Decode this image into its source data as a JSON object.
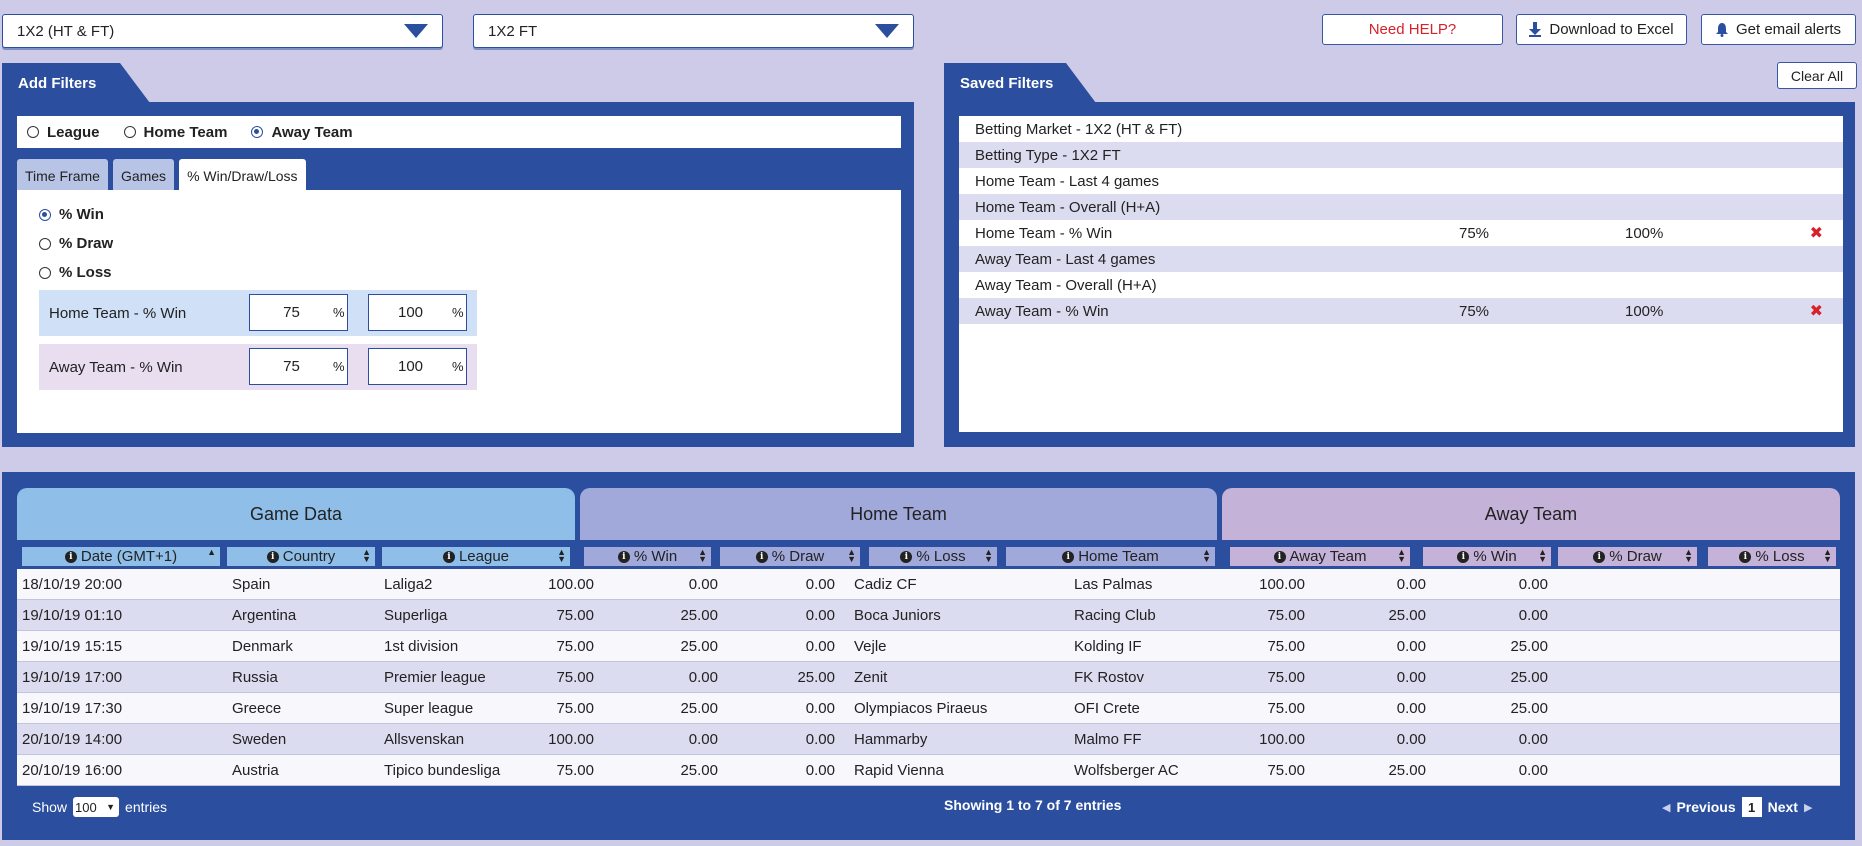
{
  "top": {
    "market_select": "1X2 (HT & FT)",
    "type_select": "1X2 FT",
    "help_label": "Need HELP?",
    "download_label": "Download to Excel",
    "alerts_label": "Get email alerts"
  },
  "add_filters": {
    "title": "Add Filters",
    "scope": [
      "League",
      "Home Team",
      "Away Team"
    ],
    "tabs": [
      "Time Frame",
      "Games",
      "% Win/Draw/Loss"
    ],
    "options": [
      "% Win",
      "% Draw",
      "% Loss"
    ],
    "home": {
      "label": "Home Team - % Win",
      "min": "75",
      "max": "100",
      "unit": "%"
    },
    "away": {
      "label": "Away Team - % Win",
      "min": "75",
      "max": "100",
      "unit": "%"
    }
  },
  "saved_filters": {
    "title": "Saved Filters",
    "clear_label": "Clear All",
    "rows": [
      {
        "name": "Betting Market - 1X2 (HT & FT)",
        "a": "",
        "b": "",
        "x": ""
      },
      {
        "name": "Betting Type - 1X2 FT",
        "a": "",
        "b": "",
        "x": ""
      },
      {
        "name": "Home Team - Last 4 games",
        "a": "",
        "b": "",
        "x": ""
      },
      {
        "name": "Home Team - Overall (H+A)",
        "a": "",
        "b": "",
        "x": ""
      },
      {
        "name": "Home Team - % Win",
        "a": "75%",
        "b": "100%",
        "x": "✖"
      },
      {
        "name": "Away Team - Last 4 games",
        "a": "",
        "b": "",
        "x": ""
      },
      {
        "name": "Away Team - Overall (H+A)",
        "a": "",
        "b": "",
        "x": ""
      },
      {
        "name": "Away Team - % Win",
        "a": "75%",
        "b": "100%",
        "x": "✖"
      }
    ]
  },
  "table": {
    "groups": [
      "Game Data",
      "Home Team",
      "Away Team"
    ],
    "columns": [
      "Date (GMT+1)",
      "Country",
      "League",
      "% Win",
      "% Draw",
      "% Loss",
      "Home Team",
      "Away Team",
      "% Win",
      "% Draw",
      "% Loss"
    ],
    "rows": [
      [
        "18/10/19 20:00",
        "Spain",
        "Laliga2",
        "100.00",
        "0.00",
        "0.00",
        "Cadiz CF",
        "Las Palmas",
        "100.00",
        "0.00",
        "0.00"
      ],
      [
        "19/10/19 01:10",
        "Argentina",
        "Superliga",
        "75.00",
        "25.00",
        "0.00",
        "Boca Juniors",
        "Racing Club",
        "75.00",
        "25.00",
        "0.00"
      ],
      [
        "19/10/19 15:15",
        "Denmark",
        "1st division",
        "75.00",
        "25.00",
        "0.00",
        "Vejle",
        "Kolding IF",
        "75.00",
        "0.00",
        "25.00"
      ],
      [
        "19/10/19 17:00",
        "Russia",
        "Premier league",
        "75.00",
        "0.00",
        "25.00",
        "Zenit",
        "FK Rostov",
        "75.00",
        "0.00",
        "25.00"
      ],
      [
        "19/10/19 17:30",
        "Greece",
        "Super league",
        "75.00",
        "25.00",
        "0.00",
        "Olympiacos Piraeus",
        "OFI Crete",
        "75.00",
        "0.00",
        "25.00"
      ],
      [
        "20/10/19 14:00",
        "Sweden",
        "Allsvenskan",
        "100.00",
        "0.00",
        "0.00",
        "Hammarby",
        "Malmo FF",
        "100.00",
        "0.00",
        "0.00"
      ],
      [
        "20/10/19 16:00",
        "Austria",
        "Tipico bundesliga",
        "75.00",
        "25.00",
        "0.00",
        "Rapid Vienna",
        "Wolfsberger AC",
        "75.00",
        "25.00",
        "0.00"
      ]
    ],
    "show_label": "Show",
    "show_value": "100",
    "entries_label": "entries",
    "info": "Showing 1 to 7 of 7 entries",
    "prev": "Previous",
    "page": "1",
    "next": "Next"
  }
}
